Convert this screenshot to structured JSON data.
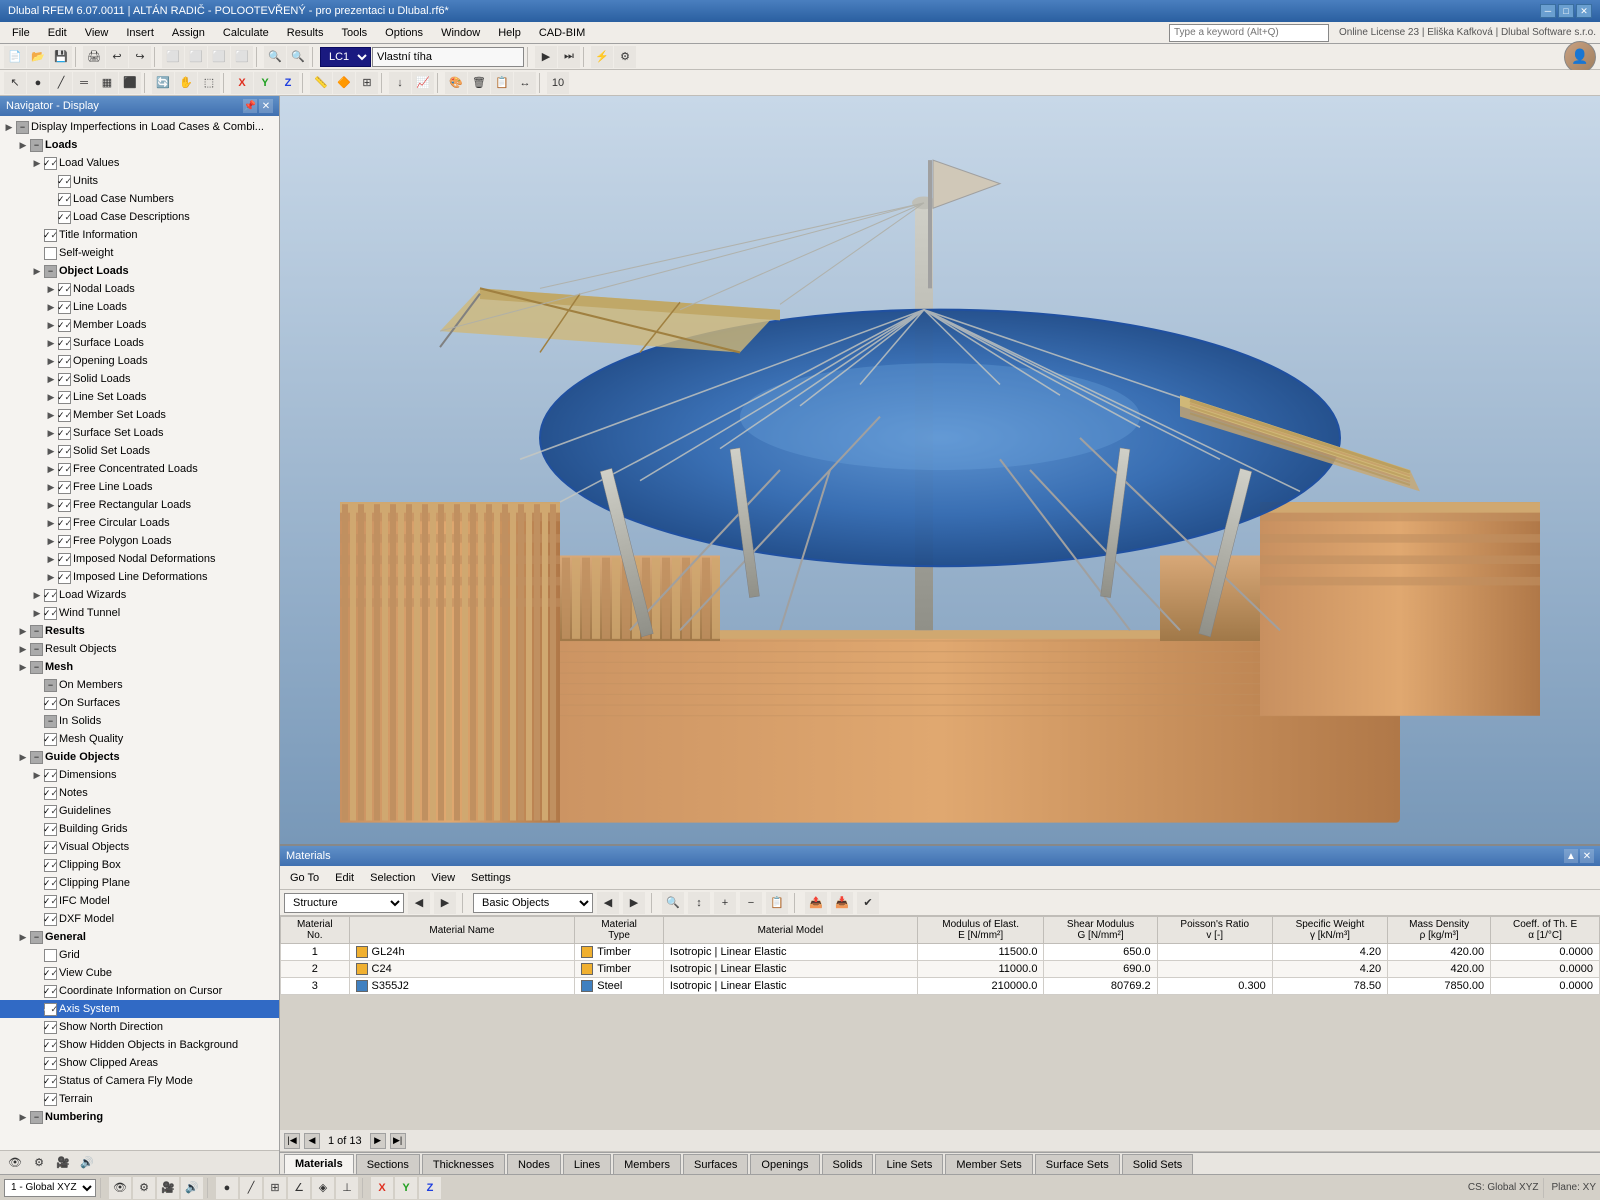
{
  "titlebar": {
    "title": "Dlubal RFEM 6.07.0011 | ALTÁN RADIČ - POLOOTEVŘENÝ - pro prezentaci u Dlubal.rf6*",
    "min": "─",
    "max": "□",
    "close": "✕"
  },
  "menu": {
    "items": [
      "File",
      "Edit",
      "View",
      "Insert",
      "Assign",
      "Calculate",
      "Results",
      "Tools",
      "Options",
      "Window",
      "Help",
      "CAD-BIM"
    ]
  },
  "topbar": {
    "search_placeholder": "Type a keyword (Alt+Q)",
    "license": "Online License 23 | Eliška Kafková | Dlubal Software s.r.o.",
    "lc_label": "LC1",
    "lc_value": "Vlastní tíha"
  },
  "navigator": {
    "title": "Navigator - Display",
    "items": [
      {
        "indent": 0,
        "expander": "▶",
        "check": "partial",
        "icon": "📋",
        "label": "Display Imperfections in Load Cases & Combi...",
        "level": 0
      },
      {
        "indent": 1,
        "expander": "▶",
        "check": "partial",
        "icon": "📁",
        "label": "Loads",
        "level": 1,
        "group": true
      },
      {
        "indent": 2,
        "expander": "▶",
        "check": "checked",
        "icon": "📊",
        "label": "Load Values",
        "level": 2
      },
      {
        "indent": 3,
        "expander": "",
        "check": "checked",
        "icon": "📝",
        "label": "Units",
        "level": 3
      },
      {
        "indent": 3,
        "expander": "",
        "check": "checked",
        "icon": "📝",
        "label": "Load Case Numbers",
        "level": 3
      },
      {
        "indent": 3,
        "expander": "",
        "check": "checked",
        "icon": "📝",
        "label": "Load Case Descriptions",
        "level": 3
      },
      {
        "indent": 2,
        "expander": "",
        "check": "checked",
        "icon": "ℹ",
        "label": "Title Information",
        "level": 2
      },
      {
        "indent": 2,
        "expander": "",
        "check": "",
        "icon": "⚖",
        "label": "Self-weight",
        "level": 2
      },
      {
        "indent": 2,
        "expander": "▶",
        "check": "partial",
        "icon": "📦",
        "label": "Object Loads",
        "level": 2,
        "group": true
      },
      {
        "indent": 3,
        "expander": "▶",
        "check": "checked",
        "icon": "🔴",
        "label": "Nodal Loads",
        "level": 3
      },
      {
        "indent": 3,
        "expander": "▶",
        "check": "checked",
        "icon": "🔴",
        "label": "Line Loads",
        "level": 3
      },
      {
        "indent": 3,
        "expander": "▶",
        "check": "checked",
        "icon": "🔴",
        "label": "Member Loads",
        "level": 3
      },
      {
        "indent": 3,
        "expander": "▶",
        "check": "checked",
        "icon": "🔴",
        "label": "Surface Loads",
        "level": 3
      },
      {
        "indent": 3,
        "expander": "▶",
        "check": "checked",
        "icon": "🔴",
        "label": "Opening Loads",
        "level": 3
      },
      {
        "indent": 3,
        "expander": "▶",
        "check": "checked",
        "icon": "🔴",
        "label": "Solid Loads",
        "level": 3
      },
      {
        "indent": 3,
        "expander": "▶",
        "check": "checked",
        "icon": "🔴",
        "label": "Line Set Loads",
        "level": 3
      },
      {
        "indent": 3,
        "expander": "▶",
        "check": "checked",
        "icon": "🔴",
        "label": "Member Set Loads",
        "level": 3
      },
      {
        "indent": 3,
        "expander": "▶",
        "check": "checked",
        "icon": "🔴",
        "label": "Surface Set Loads",
        "level": 3
      },
      {
        "indent": 3,
        "expander": "▶",
        "check": "checked",
        "icon": "🔴",
        "label": "Solid Set Loads",
        "level": 3
      },
      {
        "indent": 3,
        "expander": "▶",
        "check": "checked",
        "icon": "🔴",
        "label": "Free Concentrated Loads",
        "level": 3
      },
      {
        "indent": 3,
        "expander": "▶",
        "check": "checked",
        "icon": "🔴",
        "label": "Free Line Loads",
        "level": 3
      },
      {
        "indent": 3,
        "expander": "▶",
        "check": "checked",
        "icon": "🔴",
        "label": "Free Rectangular Loads",
        "level": 3
      },
      {
        "indent": 3,
        "expander": "▶",
        "check": "checked",
        "icon": "🔴",
        "label": "Free Circular Loads",
        "level": 3
      },
      {
        "indent": 3,
        "expander": "▶",
        "check": "checked",
        "icon": "🔴",
        "label": "Free Polygon Loads",
        "level": 3
      },
      {
        "indent": 3,
        "expander": "▶",
        "check": "checked",
        "icon": "🔴",
        "label": "Imposed Nodal Deformations",
        "level": 3
      },
      {
        "indent": 3,
        "expander": "▶",
        "check": "checked",
        "icon": "🔴",
        "label": "Imposed Line Deformations",
        "level": 3
      },
      {
        "indent": 2,
        "expander": "▶",
        "check": "checked",
        "icon": "🧙",
        "label": "Load Wizards",
        "level": 2
      },
      {
        "indent": 2,
        "expander": "▶",
        "check": "checked",
        "icon": "💨",
        "label": "Wind Tunnel",
        "level": 2
      },
      {
        "indent": 1,
        "expander": "▶",
        "check": "partial",
        "icon": "📊",
        "label": "Results",
        "level": 1,
        "group": true
      },
      {
        "indent": 1,
        "expander": "▶",
        "check": "partial",
        "icon": "📦",
        "label": "Result Objects",
        "level": 1
      },
      {
        "indent": 1,
        "expander": "▶",
        "check": "partial",
        "icon": "▦",
        "label": "Mesh",
        "level": 1,
        "group": true
      },
      {
        "indent": 2,
        "expander": "",
        "check": "partial",
        "icon": "▦",
        "label": "On Members",
        "level": 2
      },
      {
        "indent": 2,
        "expander": "",
        "check": "checked",
        "icon": "▦",
        "label": "On Surfaces",
        "level": 2
      },
      {
        "indent": 2,
        "expander": "",
        "check": "partial",
        "icon": "▦",
        "label": "In Solids",
        "level": 2
      },
      {
        "indent": 2,
        "expander": "",
        "check": "checked",
        "icon": "✔",
        "label": "Mesh Quality",
        "level": 2
      },
      {
        "indent": 1,
        "expander": "▶",
        "check": "partial",
        "icon": "📐",
        "label": "Guide Objects",
        "level": 1,
        "group": true
      },
      {
        "indent": 2,
        "expander": "▶",
        "check": "checked",
        "icon": "📐",
        "label": "Dimensions",
        "level": 2
      },
      {
        "indent": 2,
        "expander": "",
        "check": "checked",
        "icon": "📝",
        "label": "Notes",
        "level": 2
      },
      {
        "indent": 2,
        "expander": "",
        "check": "checked",
        "icon": "📏",
        "label": "Guidelines",
        "level": 2
      },
      {
        "indent": 2,
        "expander": "",
        "check": "checked",
        "icon": "⊞",
        "label": "Building Grids",
        "level": 2
      },
      {
        "indent": 2,
        "expander": "",
        "check": "checked",
        "icon": "🔷",
        "label": "Visual Objects",
        "level": 2
      },
      {
        "indent": 2,
        "expander": "",
        "check": "checked",
        "icon": "📦",
        "label": "Clipping Box",
        "level": 2
      },
      {
        "indent": 2,
        "expander": "",
        "check": "checked",
        "icon": "✂",
        "label": "Clipping Plane",
        "level": 2
      },
      {
        "indent": 2,
        "expander": "",
        "check": "checked",
        "icon": "🏗",
        "label": "IFC Model",
        "level": 2
      },
      {
        "indent": 2,
        "expander": "",
        "check": "checked",
        "icon": "📄",
        "label": "DXF Model",
        "level": 2
      },
      {
        "indent": 1,
        "expander": "▶",
        "check": "partial",
        "icon": "⚙",
        "label": "General",
        "level": 1,
        "group": true
      },
      {
        "indent": 2,
        "expander": "",
        "check": "",
        "icon": "⊞",
        "label": "Grid",
        "level": 2
      },
      {
        "indent": 2,
        "expander": "",
        "check": "checked",
        "icon": "🎲",
        "label": "View Cube",
        "level": 2
      },
      {
        "indent": 2,
        "expander": "",
        "check": "checked",
        "icon": "📍",
        "label": "Coordinate Information on Cursor",
        "level": 2
      },
      {
        "indent": 2,
        "expander": "",
        "check": "checked",
        "icon": "🔵",
        "label": "Axis System",
        "level": 2,
        "selected": true
      },
      {
        "indent": 2,
        "expander": "",
        "check": "checked",
        "icon": "🧭",
        "label": "Show North Direction",
        "level": 2
      },
      {
        "indent": 2,
        "expander": "",
        "check": "checked",
        "icon": "🖼",
        "label": "Show Hidden Objects in Background",
        "level": 2
      },
      {
        "indent": 2,
        "expander": "",
        "check": "checked",
        "icon": "✂",
        "label": "Show Clipped Areas",
        "level": 2
      },
      {
        "indent": 2,
        "expander": "",
        "check": "checked",
        "icon": "📷",
        "label": "Status of Camera Fly Mode",
        "level": 2
      },
      {
        "indent": 2,
        "expander": "",
        "check": "checked",
        "icon": "🌍",
        "label": "Terrain",
        "level": 2
      },
      {
        "indent": 1,
        "expander": "▶",
        "check": "partial",
        "icon": "🔢",
        "label": "Numbering",
        "level": 1,
        "group": true
      }
    ],
    "bottom_icons": [
      "👁",
      "⚙",
      "🎥",
      "🔊"
    ]
  },
  "materials_panel": {
    "title": "Materials",
    "menu": [
      "Go To",
      "Edit",
      "Selection",
      "View",
      "Settings"
    ],
    "structure_dropdown": "Structure",
    "basic_objects_dropdown": "Basic Objects",
    "columns": [
      "Material No.",
      "Material Name",
      "Material Type",
      "Material Model",
      "Modulus of Elast. E [N/mm²]",
      "Shear Modulus G [N/mm²]",
      "Poisson's Ratio v [-]",
      "Specific Weight γ [kN/m³]",
      "Mass Density ρ [kg/m³]",
      "Coeff. of Th. E α [1/°C]"
    ],
    "rows": [
      {
        "no": 1,
        "name": "GL24h",
        "color": "#f0b030",
        "type": "Timber",
        "model": "Isotropic | Linear Elastic",
        "E": "11500.0",
        "G": "650.0",
        "v": "",
        "gamma": "4.20",
        "rho": "420.00",
        "alpha": "0.0000"
      },
      {
        "no": 2,
        "name": "C24",
        "color": "#f0b030",
        "type": "Timber",
        "model": "Isotropic | Linear Elastic",
        "E": "11000.0",
        "G": "690.0",
        "v": "",
        "gamma": "4.20",
        "rho": "420.00",
        "alpha": "0.0000"
      },
      {
        "no": 3,
        "name": "S355J2",
        "color": "#4080c0",
        "type": "Steel",
        "model": "Isotropic | Linear Elastic",
        "E": "210000.0",
        "G": "80769.2",
        "v": "0.300",
        "gamma": "78.50",
        "rho": "7850.00",
        "alpha": "0.0000"
      }
    ],
    "page_info": "1 of 13"
  },
  "bottom_tabs": {
    "tabs": [
      "Materials",
      "Sections",
      "Thicknesses",
      "Nodes",
      "Lines",
      "Members",
      "Surfaces",
      "Openings",
      "Solids",
      "Line Sets",
      "Member Sets",
      "Surface Sets",
      "Solid Sets"
    ]
  },
  "status_bar": {
    "item_number": "1 - Global XYZ",
    "cs": "CS: Global XYZ",
    "plane": "Plane: XY"
  }
}
